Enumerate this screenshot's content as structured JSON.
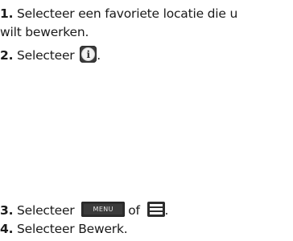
{
  "steps": [
    {
      "number": "1.",
      "text_line1": "Selecteer een favoriete locatie die u",
      "text_line2": "wilt bewerken."
    },
    {
      "number": "2.",
      "text_before": "Selecteer",
      "icon": "info-icon",
      "icon_glyph": "i",
      "text_after": "."
    },
    {
      "number": "3.",
      "text_before": "Selecteer",
      "button_label": "MENU",
      "connector": "of",
      "icon": "hamburger-menu-icon",
      "text_after": "."
    },
    {
      "number": "4.",
      "text_before": "Selecteer",
      "emphasis": "Bewerk",
      "text_after": "."
    }
  ]
}
